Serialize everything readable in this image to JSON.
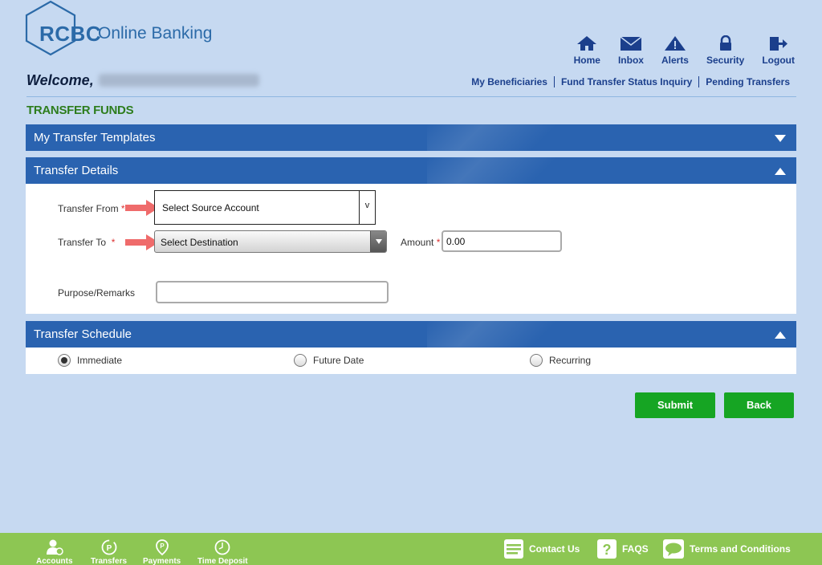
{
  "brand": {
    "logo_short": "RCBC",
    "logo_rest": "Online Banking",
    "color": "#2b6aa8"
  },
  "topnav": [
    {
      "label": "Home",
      "icon": "home-icon"
    },
    {
      "label": "Inbox",
      "icon": "envelope-icon"
    },
    {
      "label": "Alerts",
      "icon": "warning-icon"
    },
    {
      "label": "Security",
      "icon": "lock-icon"
    },
    {
      "label": "Logout",
      "icon": "logout-icon"
    }
  ],
  "welcome": "Welcome,",
  "sublinks": [
    "My Beneficiaries",
    "Fund Transfer Status Inquiry",
    "Pending Transfers"
  ],
  "page_title": "TRANSFER FUNDS",
  "sections": {
    "templates": "My Transfer Templates",
    "details": "Transfer Details",
    "schedule": "Transfer Schedule"
  },
  "form": {
    "from_label": "Transfer From",
    "from_value": "Select Source Account",
    "from_button": "v",
    "to_label": "Transfer To",
    "to_value": "Select Destination",
    "amount_label": "Amount",
    "amount_value": "0.00",
    "remarks_label": "Purpose/Remarks",
    "remarks_value": "",
    "required_mark": "*"
  },
  "schedule_options": [
    {
      "label": "Immediate",
      "selected": true
    },
    {
      "label": "Future Date",
      "selected": false
    },
    {
      "label": "Recurring",
      "selected": false
    }
  ],
  "buttons": {
    "submit": "Submit",
    "back": "Back"
  },
  "footer_nav": [
    "Accounts",
    "Transfers",
    "Payments",
    "Time Deposit"
  ],
  "footer_links": [
    "Contact Us",
    "FAQS",
    "Terms and Conditions"
  ],
  "colors": {
    "band": "#2a63b0",
    "title_green": "#2d7d1d",
    "button_green": "#16a523",
    "footer": "#8dc653",
    "arrow": "#ef6b6b"
  }
}
